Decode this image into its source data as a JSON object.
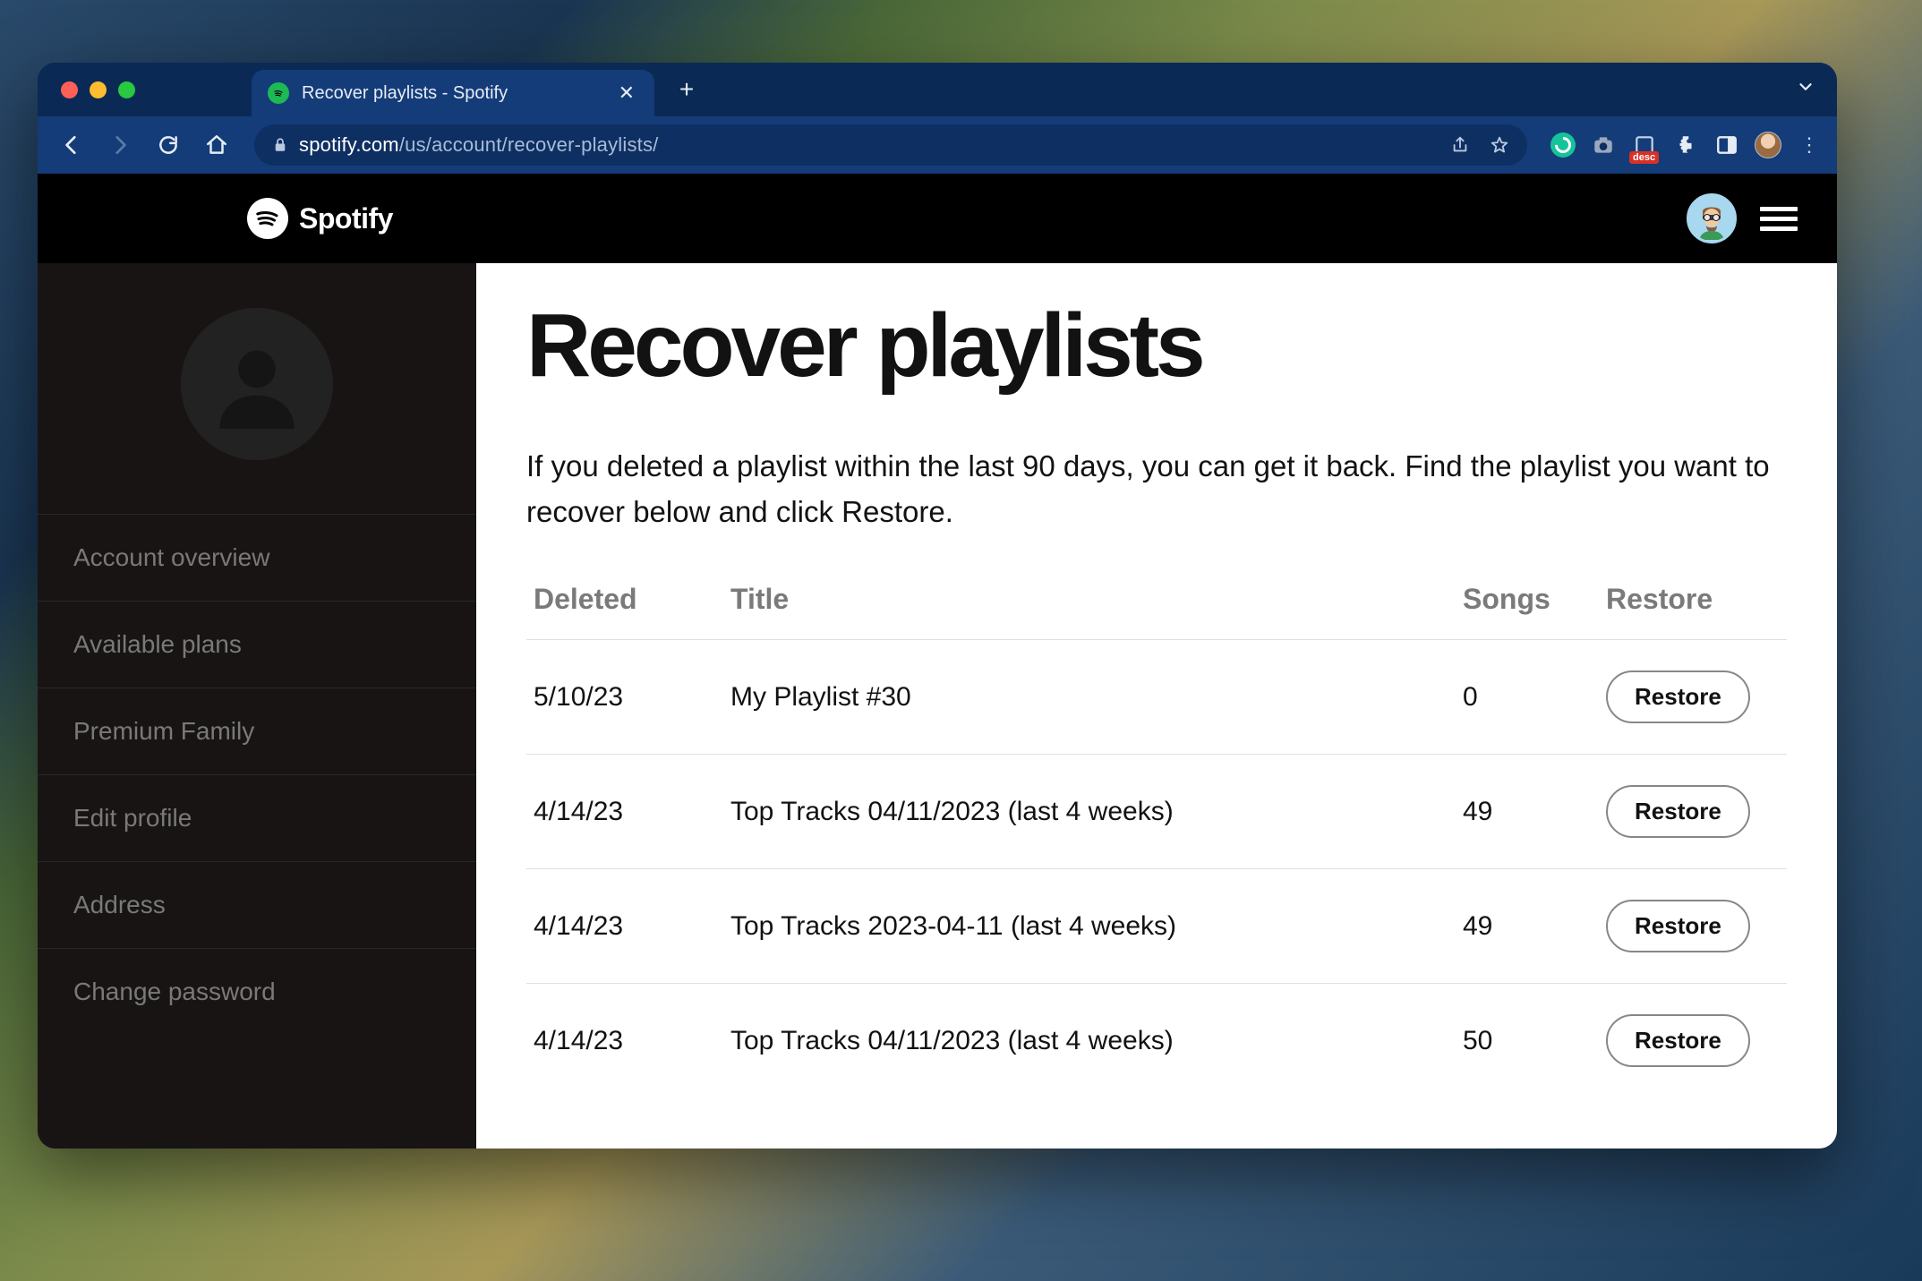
{
  "browser": {
    "tab_title": "Recover playlists - Spotify",
    "url_domain": "spotify.com",
    "url_path": "/us/account/recover-playlists/",
    "ext_badge": "desc"
  },
  "header": {
    "brand": "Spotify"
  },
  "sidebar": {
    "items": [
      {
        "label": "Account overview"
      },
      {
        "label": "Available plans"
      },
      {
        "label": "Premium Family"
      },
      {
        "label": "Edit profile"
      },
      {
        "label": "Address"
      },
      {
        "label": "Change password"
      }
    ]
  },
  "main": {
    "title": "Recover playlists",
    "description": "If you deleted a playlist within the last 90 days, you can get it back. Find the playlist you want to recover below and click Restore.",
    "columns": {
      "deleted": "Deleted",
      "title": "Title",
      "songs": "Songs",
      "restore": "Restore"
    },
    "restore_label": "Restore",
    "rows": [
      {
        "deleted": "5/10/23",
        "title": "My Playlist #30",
        "songs": "0"
      },
      {
        "deleted": "4/14/23",
        "title": "Top Tracks 04/11/2023 (last 4 weeks)",
        "songs": "49"
      },
      {
        "deleted": "4/14/23",
        "title": "Top Tracks 2023-04-11 (last 4 weeks)",
        "songs": "49"
      },
      {
        "deleted": "4/14/23",
        "title": "Top Tracks 04/11/2023 (last 4 weeks)",
        "songs": "50"
      }
    ]
  }
}
